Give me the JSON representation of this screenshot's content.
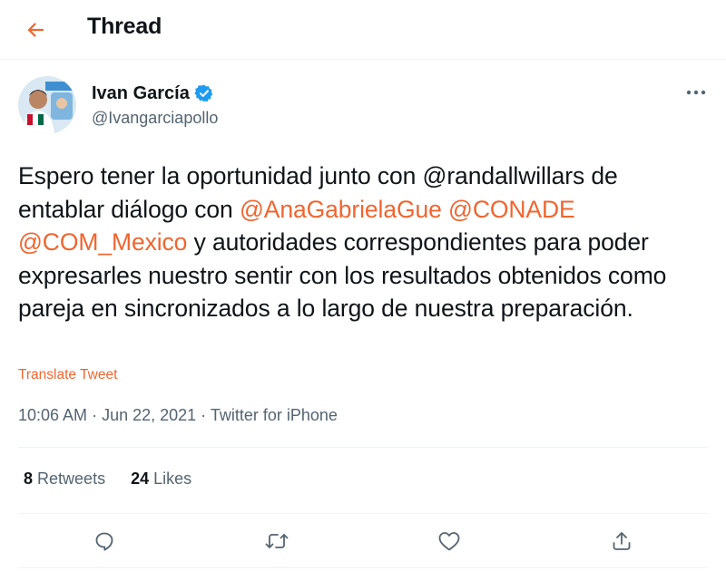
{
  "header": {
    "title": "Thread",
    "back_icon": "arrow-left-icon"
  },
  "colors": {
    "accent": "#f0652f",
    "text": "#0f1419",
    "secondary": "#536471",
    "verified": "#1d9bf0"
  },
  "tweet": {
    "author": {
      "name": "Ivan García",
      "handle": "@Ivangarciapollo",
      "verified": true
    },
    "text": {
      "part1": "Espero tener la oportunidad junto con @randallwillars de entablar diálogo con ",
      "mention1": "@AnaGabrielaGue",
      "sep1": " ",
      "mention2": "@CONADE",
      "sep2": " ",
      "mention3": "@COM_Mexico",
      "part2": " y autoridades correspondientes para poder expresarles nuestro sentir con los resultados obtenidos como pareja en sincronizados a lo largo de nuestra preparación."
    },
    "translate_label": "Translate Tweet",
    "time": "10:06 AM",
    "date": "Jun 22, 2021",
    "source": "Twitter for iPhone",
    "separator": " · ",
    "stats": {
      "retweets_count": "8",
      "retweets_label": "Retweets",
      "likes_count": "24",
      "likes_label": "Likes"
    },
    "actions": [
      "reply-icon",
      "retweet-icon",
      "like-icon",
      "share-icon"
    ]
  }
}
